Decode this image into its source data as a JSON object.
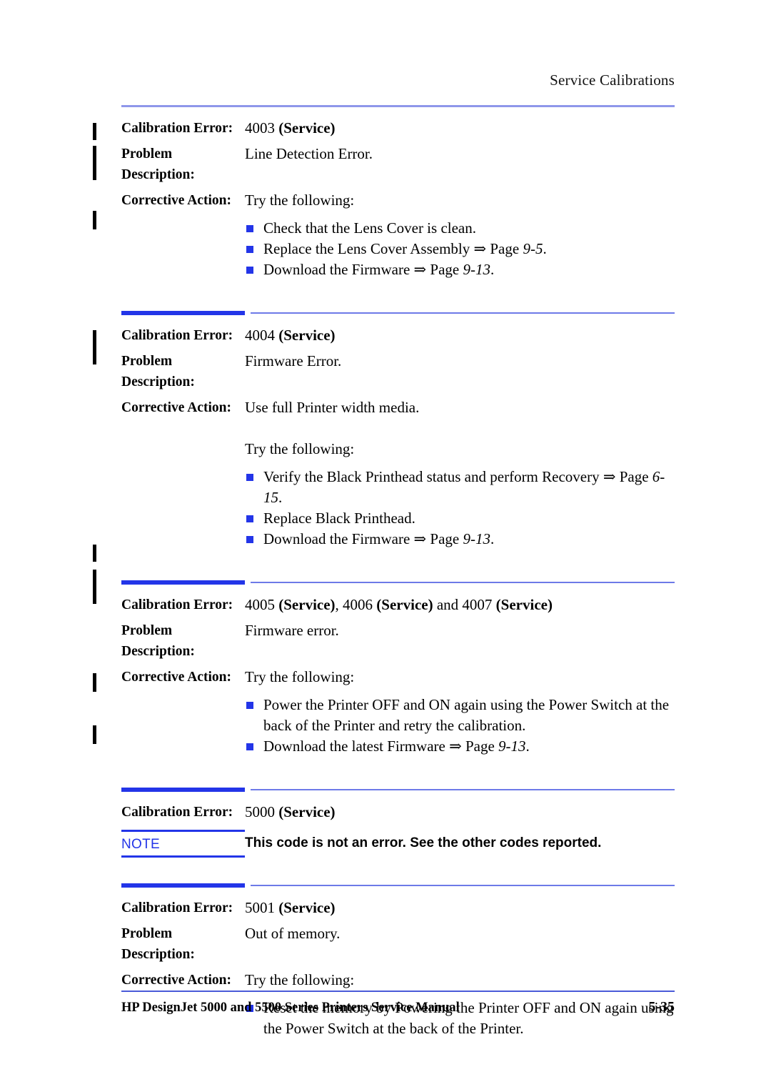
{
  "header": {
    "chapter_title": "Service Calibrations"
  },
  "labels": {
    "calibration_error": "Calibration Error:",
    "problem": "Problem",
    "description": "Description:",
    "corrective_action": "Corrective Action:",
    "note_tag": "NOTE"
  },
  "colors": {
    "accent_blue": "#2335e8",
    "rule_light_blue": "#8f97ea",
    "thin_rule_blue": "#6d7ae8",
    "text_black": "#000000"
  },
  "entries": [
    {
      "error_code": "4003",
      "error_qualifier": "(Service)",
      "problem_description": "Line Detection Error.",
      "corrective_intro": "Try the following:",
      "bullets": [
        {
          "text_before": "Check that the Lens Cover is clean.",
          "arrow": "",
          "page_label": "",
          "page_ref": "",
          "tail": ""
        },
        {
          "text_before": "Replace the Lens Cover Assembly ",
          "arrow": "⇒",
          "page_label": " Page ",
          "page_ref": "9-5",
          "tail": "."
        },
        {
          "text_before": "Download the Firmware ",
          "arrow": "⇒",
          "page_label": " Page ",
          "page_ref": "9-13",
          "tail": "."
        }
      ]
    },
    {
      "error_code": "4004",
      "error_qualifier": "(Service)",
      "problem_description": "Firmware Error.",
      "corrective_first_line": "Use full Printer width media.",
      "corrective_intro": "Try the following:",
      "bullets": [
        {
          "text_before": "Verify the Black Printhead status and perform Recovery ",
          "arrow": "⇒",
          "page_label": " Page ",
          "page_ref": "6-15",
          "tail": "."
        },
        {
          "text_before": "Replace Black Printhead.",
          "arrow": "",
          "page_label": "",
          "page_ref": "",
          "tail": ""
        },
        {
          "text_before": "Download the Firmware ",
          "arrow": "⇒",
          "page_label": " Page ",
          "page_ref": "9-13",
          "tail": "."
        }
      ]
    },
    {
      "error_code_multi": "4005 (Service), 4006 (Service) and 4007 (Service)",
      "problem_description": "Firmware error.",
      "corrective_intro": "Try the following:",
      "bullets": [
        {
          "text_before": "Power the Printer OFF and ON again using the Power Switch at the back of the Printer and retry the calibration.",
          "arrow": "",
          "page_label": "",
          "page_ref": "",
          "tail": ""
        },
        {
          "text_before": "Download the latest Firmware ",
          "arrow": "⇒",
          "page_label": " Page ",
          "page_ref": "9-13",
          "tail": "."
        }
      ]
    },
    {
      "error_code": "5000",
      "error_qualifier": "(Service)",
      "note_text": "This code is not an error. See the other codes reported."
    },
    {
      "error_code": "5001",
      "error_qualifier": "(Service)",
      "problem_description": "Out of memory.",
      "corrective_intro": "Try the following:",
      "bullets": [
        {
          "text_before": "Reset the memory by Powering the Printer OFF and ON again using the Power Switch at the back of the Printer.",
          "arrow": "",
          "page_label": "",
          "page_ref": "",
          "tail": ""
        }
      ]
    }
  ],
  "footer": {
    "manual_title": "HP DesignJet 5000 and 5500 Series Printers Service Manual",
    "page_number": "5-35"
  }
}
